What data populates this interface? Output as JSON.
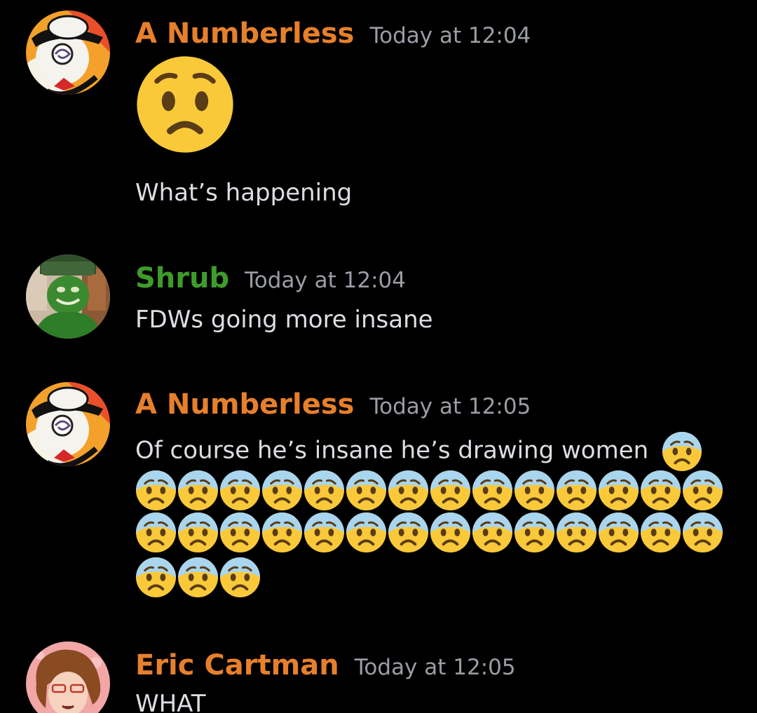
{
  "colors": {
    "background": "#000000",
    "name_orange": "#e6802c",
    "name_green": "#3e9c2a",
    "timestamp": "#9a9da4",
    "text": "#dcdee3"
  },
  "messages": [
    {
      "author": "A Numberless",
      "timestamp": "Today at 12:04",
      "big_emoji": "worried-face",
      "text": "What’s happening"
    },
    {
      "author": "Shrub",
      "timestamp": "Today at 12:04",
      "text": "FDWs going more insane"
    },
    {
      "author": "A Numberless",
      "timestamp": "Today at 12:05",
      "text": "Of course he’s insane he’s drawing women",
      "emoji": "anxious-face",
      "emoji_count": 32
    },
    {
      "author": "Eric Cartman",
      "timestamp": "Today at 12:05",
      "text": "WHAT"
    }
  ]
}
